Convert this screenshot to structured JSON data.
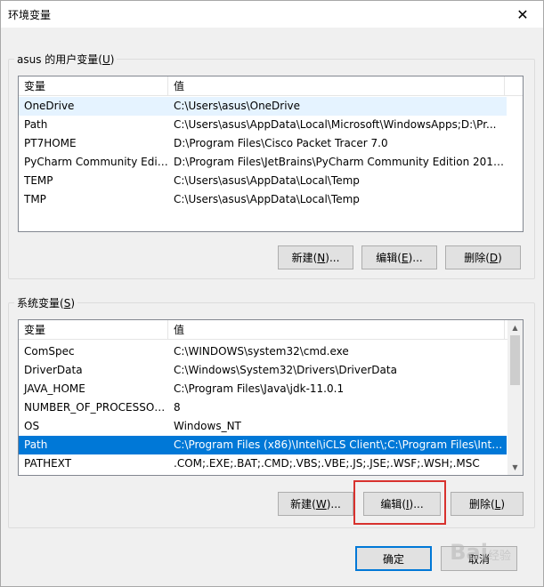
{
  "window": {
    "title": "环境变量",
    "close_glyph": "✕"
  },
  "user_vars": {
    "group_label": "asus 的用户变量",
    "group_mnemonic": "U",
    "columns": [
      "变量",
      "值"
    ],
    "rows": [
      [
        "OneDrive",
        "C:\\Users\\asus\\OneDrive"
      ],
      [
        "Path",
        "C:\\Users\\asus\\AppData\\Local\\Microsoft\\WindowsApps;D:\\Pr..."
      ],
      [
        "PT7HOME",
        "D:\\Program Files\\Cisco Packet Tracer 7.0"
      ],
      [
        "PyCharm Community Editi...",
        "D:\\Program Files\\JetBrains\\PyCharm Community Edition 2018..."
      ],
      [
        "TEMP",
        "C:\\Users\\asus\\AppData\\Local\\Temp"
      ],
      [
        "TMP",
        "C:\\Users\\asus\\AppData\\Local\\Temp"
      ]
    ],
    "buttons": {
      "new": {
        "pre": "新建(",
        "key": "N",
        "post": ")..."
      },
      "edit": {
        "pre": "编辑(",
        "key": "E",
        "post": ")..."
      },
      "delete": {
        "pre": "删除(",
        "key": "D",
        "post": ")"
      }
    }
  },
  "system_vars": {
    "group_label": "系统变量",
    "group_mnemonic": "S",
    "columns": [
      "变量",
      "值"
    ],
    "rows": [
      [
        "ComSpec",
        "C:\\WINDOWS\\system32\\cmd.exe"
      ],
      [
        "DriverData",
        "C:\\Windows\\System32\\Drivers\\DriverData"
      ],
      [
        "JAVA_HOME",
        "C:\\Program Files\\Java\\jdk-11.0.1"
      ],
      [
        "NUMBER_OF_PROCESSORS",
        "8"
      ],
      [
        "OS",
        "Windows_NT"
      ],
      [
        "Path",
        "C:\\Program Files (x86)\\Intel\\iCLS Client\\;C:\\Program Files\\Intel..."
      ],
      [
        "PATHEXT",
        ".COM;.EXE;.BAT;.CMD;.VBS;.VBE;.JS;.JSE;.WSF;.WSH;.MSC"
      ]
    ],
    "selected_row": 5,
    "buttons": {
      "new": {
        "pre": "新建(",
        "key": "W",
        "post": ")..."
      },
      "edit": {
        "pre": "编辑(",
        "key": "I",
        "post": ")..."
      },
      "delete": {
        "pre": "删除(",
        "key": "L",
        "post": ")"
      }
    }
  },
  "footer": {
    "ok": "确定",
    "cancel": "取消"
  },
  "watermark": {
    "brand": "Bai",
    "suffix": "经验"
  },
  "colors": {
    "selection": "#0078d7",
    "highlight_box": "#d8322e"
  }
}
